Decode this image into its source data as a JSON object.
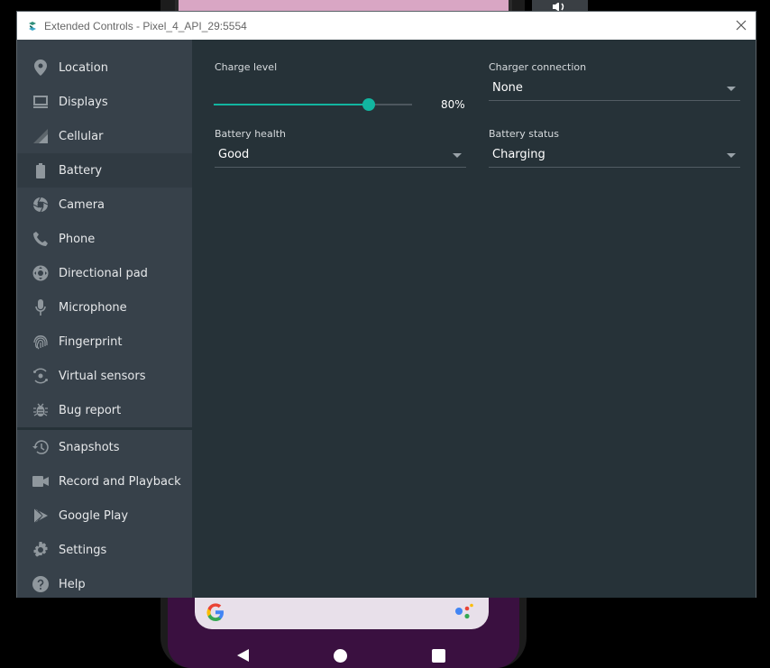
{
  "window": {
    "title": "Extended Controls - Pixel_4_API_29:5554"
  },
  "sidebar": {
    "items": [
      {
        "label": "Location",
        "icon": "location-icon"
      },
      {
        "label": "Displays",
        "icon": "display-icon"
      },
      {
        "label": "Cellular",
        "icon": "cellular-icon"
      },
      {
        "label": "Battery",
        "icon": "battery-icon",
        "active": true
      },
      {
        "label": "Camera",
        "icon": "camera-icon"
      },
      {
        "label": "Phone",
        "icon": "phone-icon"
      },
      {
        "label": "Directional pad",
        "icon": "dpad-icon"
      },
      {
        "label": "Microphone",
        "icon": "microphone-icon"
      },
      {
        "label": "Fingerprint",
        "icon": "fingerprint-icon"
      },
      {
        "label": "Virtual sensors",
        "icon": "sensors-icon"
      },
      {
        "label": "Bug report",
        "icon": "bug-icon"
      }
    ],
    "items2": [
      {
        "label": "Snapshots",
        "icon": "history-icon"
      },
      {
        "label": "Record and Playback",
        "icon": "video-icon"
      },
      {
        "label": "Google Play",
        "icon": "play-icon"
      },
      {
        "label": "Settings",
        "icon": "gear-icon"
      },
      {
        "label": "Help",
        "icon": "help-icon"
      }
    ]
  },
  "battery": {
    "charge_level_label": "Charge level",
    "charge_level_value": 80,
    "charge_level_text": "80%",
    "charger_connection_label": "Charger connection",
    "charger_connection_value": "None",
    "battery_health_label": "Battery health",
    "battery_health_value": "Good",
    "battery_status_label": "Battery status",
    "battery_status_value": "Charging"
  },
  "colors": {
    "accent": "#12b5a0",
    "sidebar_bg": "#37414a",
    "content_bg": "#263238"
  }
}
